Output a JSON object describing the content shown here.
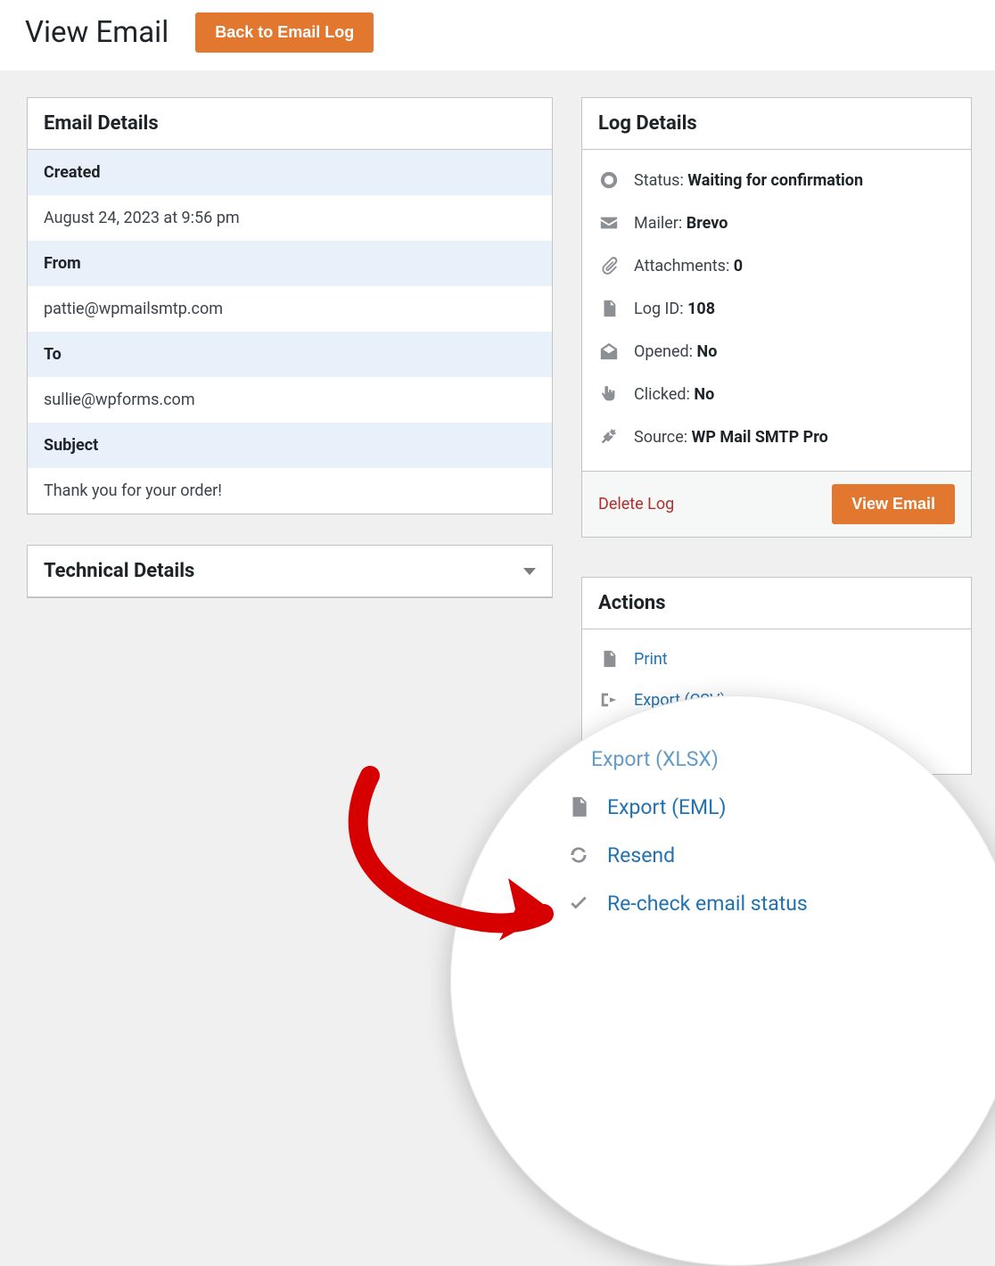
{
  "header": {
    "title": "View Email",
    "back_button": "Back to Email Log"
  },
  "email_details": {
    "panel_title": "Email Details",
    "labels": {
      "created": "Created",
      "from": "From",
      "to": "To",
      "subject": "Subject"
    },
    "values": {
      "created": "August 24, 2023 at 9:56 pm",
      "from": "pattie@wpmailsmtp.com",
      "to": "sullie@wpforms.com",
      "subject": "Thank you for your order!"
    }
  },
  "technical_details": {
    "panel_title": "Technical Details"
  },
  "log_details": {
    "panel_title": "Log Details",
    "status_label": "Status:",
    "status_value": "Waiting for confirmation",
    "mailer_label": "Mailer:",
    "mailer_value": "Brevo",
    "attachments_label": "Attachments:",
    "attachments_value": "0",
    "logid_label": "Log ID:",
    "logid_value": "108",
    "opened_label": "Opened:",
    "opened_value": "No",
    "clicked_label": "Clicked:",
    "clicked_value": "No",
    "source_label": "Source:",
    "source_value": "WP Mail SMTP Pro",
    "delete_label": "Delete Log",
    "view_button": "View Email"
  },
  "actions": {
    "panel_title": "Actions",
    "print": "Print",
    "export_csv": "Export (CSV)",
    "export_xlsx": "Export (XLSX)",
    "export_eml": "Export (EML)",
    "resend": "Resend",
    "recheck": "Re-check email status"
  }
}
